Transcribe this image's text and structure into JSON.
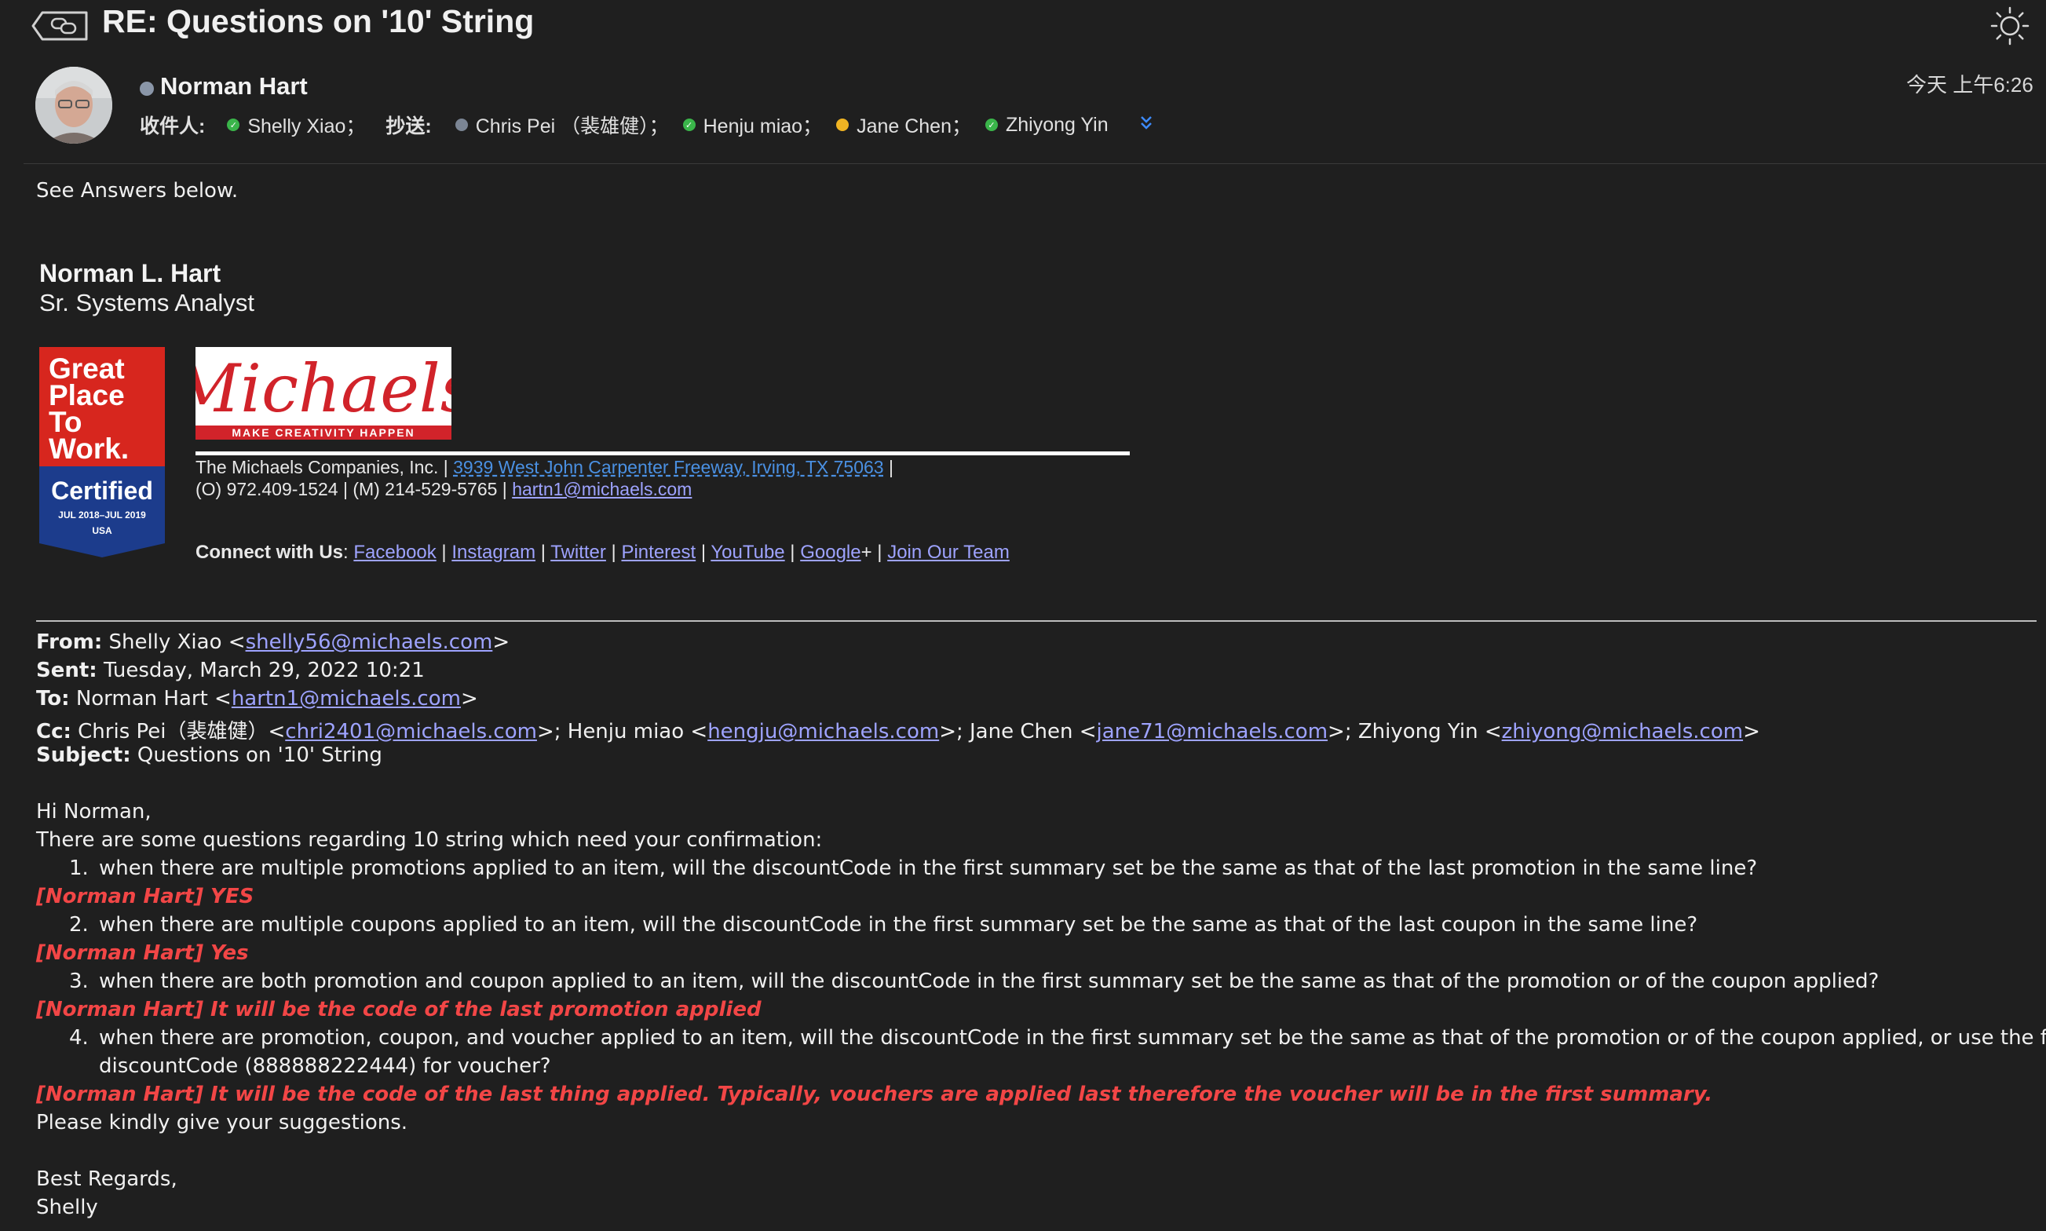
{
  "header": {
    "title": "RE: Questions on '10' String",
    "date": "今天 上午6:26"
  },
  "sender": {
    "name": "Norman Hart"
  },
  "recipients": {
    "to_label": "收件人:",
    "to": [
      "Shelly Xiao；"
    ],
    "cc_label": "抄送:",
    "cc": [
      "Chris Pei （裴雄健）；",
      "Henju miao；",
      "Jane Chen；",
      "Zhiyong Yin"
    ]
  },
  "body": {
    "intro": "See Answers below."
  },
  "signature": {
    "name": "Norman L. Hart",
    "title": "Sr. Systems Analyst",
    "badge": {
      "line1": "Great",
      "line2": "Place",
      "line3": "To",
      "line4": "Work.",
      "certified": "Certified",
      "dates": "JUL 2018–JUL 2019",
      "country": "USA"
    },
    "logo_text": "Michaels",
    "logo_tagline": "MAKE CREATIVITY HAPPEN",
    "company": "The Michaels Companies, Inc.  |  ",
    "address": "3939 West John Carpenter Freeway, Irving, TX 75063",
    "address_tail": "  |",
    "phones": "(O) 972.409-1524  |  (M) 214-529-5765  |  ",
    "email": "hartn1@michaels.com",
    "connect_label": "Connect with Us",
    "social": [
      "Facebook",
      "Instagram",
      "Twitter",
      "Pinterest",
      "YouTube",
      "Google",
      "Join Our Team"
    ]
  },
  "quoted": {
    "from_label": "From:",
    "from_name": "Shelly Xiao <",
    "from_email": "shelly56@michaels.com",
    "sent_label": "Sent:",
    "sent_value": "Tuesday, March 29, 2022 10:21",
    "to_label": "To:",
    "to_name": "Norman Hart <",
    "to_email": "hartn1@michaels.com",
    "cc_label": "Cc:",
    "cc_1_name": "Chris Pei（裴雄健）<",
    "cc_1_email": "chri2401@michaels.com",
    "cc_2_name": ">; Henju miao <",
    "cc_2_email": "hengju@michaels.com",
    "cc_3_name": ">; Jane Chen <",
    "cc_3_email": "jane71@michaels.com",
    "cc_4_name": ">; Zhiyong Yin <",
    "cc_4_email": "zhiyong@michaels.com",
    "subject_label": "Subject:",
    "subject_value": "Questions on '10' String",
    "greeting": "Hi Norman,",
    "intro": "There are some questions regarding 10 string which need your confirmation:",
    "q1": "when there are multiple promotions applied to an item, will the discountCode in the first summary set be the same as that of the last promotion in the same line?",
    "a1": "[Norman Hart] YES",
    "q2": "when there are multiple coupons applied to an item, will the discountCode in the first summary set be the same as that of the last coupon in the same line?",
    "a2": "[Norman Hart] Yes",
    "q3": "when there are both promotion and coupon applied to an item, will the discountCode in the first summary set be the same as that of the promotion or of the coupon applied?",
    "a3": "[Norman Hart] It will be the code of the last promotion applied",
    "q4a": "when there are promotion, coupon, and voucher applied to an item, will the discountCode in the first summary set be the same as that of the promotion or of the coupon applied, or use the fixed",
    "q4b": "discountCode (888888222444) for voucher?",
    "a4": "[Norman Hart] It will be the code of the last thing applied.  Typically, vouchers are applied last therefore the voucher will be in the first summary.",
    "closing": "Please kindly give your suggestions.",
    "regards": "Best Regards,",
    "signoff": "Shelly"
  }
}
